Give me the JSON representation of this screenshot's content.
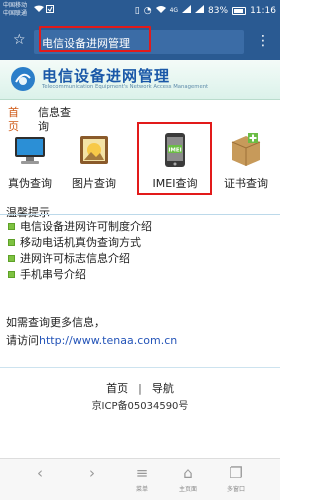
{
  "status_bar": {
    "carrier_1": "中国移动",
    "carrier_2": "中国联通",
    "signal_4g": "4G",
    "battery_percent": "83%",
    "time": "11:16"
  },
  "browser": {
    "url_text": "电信设备进网管理",
    "favorite_icon": "star-icon",
    "menu_icon": "more-icon"
  },
  "banner": {
    "title": "电信设备进网管理",
    "subtitle": "Telecommunication Equipment's Network Access Management"
  },
  "tabs": {
    "home_line1": "首",
    "home_line2": "页",
    "info_line1": "信息查",
    "info_line2": "询"
  },
  "query_icons": [
    {
      "label": "真伪查询",
      "icon": "monitor-icon"
    },
    {
      "label": "图片查询",
      "icon": "picture-icon"
    },
    {
      "label": "IMEI查询",
      "icon": "imei-phone-icon"
    },
    {
      "label": "证书查询",
      "icon": "certificate-box-icon"
    }
  ],
  "tips": {
    "title": "温馨提示",
    "items": [
      "电信设备进网许可制度介绍",
      "移动电话机真伪查询方式",
      "进网许可标志信息介绍",
      "手机串号介绍"
    ]
  },
  "contact": {
    "more_text": "如需查询更多信息，",
    "visit_prefix": "请访问",
    "link": "http://www.tenaa.com.cn"
  },
  "footer": {
    "home": "首页",
    "separator": "|",
    "nav": "导航",
    "icp": "京ICP备05034590号"
  },
  "bottom_bar": {
    "menu_label": "菜单",
    "home_label": "主页面",
    "windows_label": "多窗口"
  },
  "colors": {
    "browser_bar": "#2a5a92",
    "highlight_red": "#e21a1a",
    "banner_blue": "#1a58a8",
    "bullet_green": "#7ec241",
    "link_blue": "#2454b8"
  }
}
